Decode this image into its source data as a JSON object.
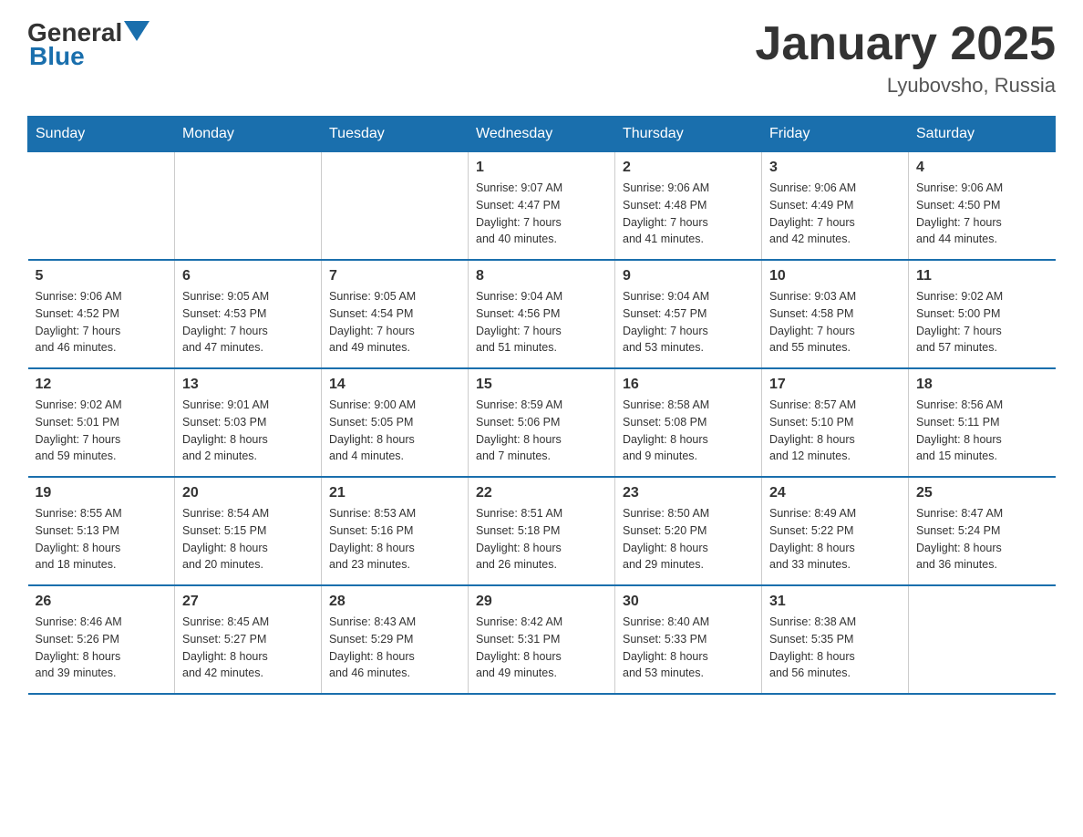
{
  "logo": {
    "general": "General",
    "blue": "Blue"
  },
  "title": "January 2025",
  "subtitle": "Lyubovsho, Russia",
  "days_of_week": [
    "Sunday",
    "Monday",
    "Tuesday",
    "Wednesday",
    "Thursday",
    "Friday",
    "Saturday"
  ],
  "weeks": [
    [
      {
        "day": "",
        "info": ""
      },
      {
        "day": "",
        "info": ""
      },
      {
        "day": "",
        "info": ""
      },
      {
        "day": "1",
        "info": "Sunrise: 9:07 AM\nSunset: 4:47 PM\nDaylight: 7 hours\nand 40 minutes."
      },
      {
        "day": "2",
        "info": "Sunrise: 9:06 AM\nSunset: 4:48 PM\nDaylight: 7 hours\nand 41 minutes."
      },
      {
        "day": "3",
        "info": "Sunrise: 9:06 AM\nSunset: 4:49 PM\nDaylight: 7 hours\nand 42 minutes."
      },
      {
        "day": "4",
        "info": "Sunrise: 9:06 AM\nSunset: 4:50 PM\nDaylight: 7 hours\nand 44 minutes."
      }
    ],
    [
      {
        "day": "5",
        "info": "Sunrise: 9:06 AM\nSunset: 4:52 PM\nDaylight: 7 hours\nand 46 minutes."
      },
      {
        "day": "6",
        "info": "Sunrise: 9:05 AM\nSunset: 4:53 PM\nDaylight: 7 hours\nand 47 minutes."
      },
      {
        "day": "7",
        "info": "Sunrise: 9:05 AM\nSunset: 4:54 PM\nDaylight: 7 hours\nand 49 minutes."
      },
      {
        "day": "8",
        "info": "Sunrise: 9:04 AM\nSunset: 4:56 PM\nDaylight: 7 hours\nand 51 minutes."
      },
      {
        "day": "9",
        "info": "Sunrise: 9:04 AM\nSunset: 4:57 PM\nDaylight: 7 hours\nand 53 minutes."
      },
      {
        "day": "10",
        "info": "Sunrise: 9:03 AM\nSunset: 4:58 PM\nDaylight: 7 hours\nand 55 minutes."
      },
      {
        "day": "11",
        "info": "Sunrise: 9:02 AM\nSunset: 5:00 PM\nDaylight: 7 hours\nand 57 minutes."
      }
    ],
    [
      {
        "day": "12",
        "info": "Sunrise: 9:02 AM\nSunset: 5:01 PM\nDaylight: 7 hours\nand 59 minutes."
      },
      {
        "day": "13",
        "info": "Sunrise: 9:01 AM\nSunset: 5:03 PM\nDaylight: 8 hours\nand 2 minutes."
      },
      {
        "day": "14",
        "info": "Sunrise: 9:00 AM\nSunset: 5:05 PM\nDaylight: 8 hours\nand 4 minutes."
      },
      {
        "day": "15",
        "info": "Sunrise: 8:59 AM\nSunset: 5:06 PM\nDaylight: 8 hours\nand 7 minutes."
      },
      {
        "day": "16",
        "info": "Sunrise: 8:58 AM\nSunset: 5:08 PM\nDaylight: 8 hours\nand 9 minutes."
      },
      {
        "day": "17",
        "info": "Sunrise: 8:57 AM\nSunset: 5:10 PM\nDaylight: 8 hours\nand 12 minutes."
      },
      {
        "day": "18",
        "info": "Sunrise: 8:56 AM\nSunset: 5:11 PM\nDaylight: 8 hours\nand 15 minutes."
      }
    ],
    [
      {
        "day": "19",
        "info": "Sunrise: 8:55 AM\nSunset: 5:13 PM\nDaylight: 8 hours\nand 18 minutes."
      },
      {
        "day": "20",
        "info": "Sunrise: 8:54 AM\nSunset: 5:15 PM\nDaylight: 8 hours\nand 20 minutes."
      },
      {
        "day": "21",
        "info": "Sunrise: 8:53 AM\nSunset: 5:16 PM\nDaylight: 8 hours\nand 23 minutes."
      },
      {
        "day": "22",
        "info": "Sunrise: 8:51 AM\nSunset: 5:18 PM\nDaylight: 8 hours\nand 26 minutes."
      },
      {
        "day": "23",
        "info": "Sunrise: 8:50 AM\nSunset: 5:20 PM\nDaylight: 8 hours\nand 29 minutes."
      },
      {
        "day": "24",
        "info": "Sunrise: 8:49 AM\nSunset: 5:22 PM\nDaylight: 8 hours\nand 33 minutes."
      },
      {
        "day": "25",
        "info": "Sunrise: 8:47 AM\nSunset: 5:24 PM\nDaylight: 8 hours\nand 36 minutes."
      }
    ],
    [
      {
        "day": "26",
        "info": "Sunrise: 8:46 AM\nSunset: 5:26 PM\nDaylight: 8 hours\nand 39 minutes."
      },
      {
        "day": "27",
        "info": "Sunrise: 8:45 AM\nSunset: 5:27 PM\nDaylight: 8 hours\nand 42 minutes."
      },
      {
        "day": "28",
        "info": "Sunrise: 8:43 AM\nSunset: 5:29 PM\nDaylight: 8 hours\nand 46 minutes."
      },
      {
        "day": "29",
        "info": "Sunrise: 8:42 AM\nSunset: 5:31 PM\nDaylight: 8 hours\nand 49 minutes."
      },
      {
        "day": "30",
        "info": "Sunrise: 8:40 AM\nSunset: 5:33 PM\nDaylight: 8 hours\nand 53 minutes."
      },
      {
        "day": "31",
        "info": "Sunrise: 8:38 AM\nSunset: 5:35 PM\nDaylight: 8 hours\nand 56 minutes."
      },
      {
        "day": "",
        "info": ""
      }
    ]
  ]
}
